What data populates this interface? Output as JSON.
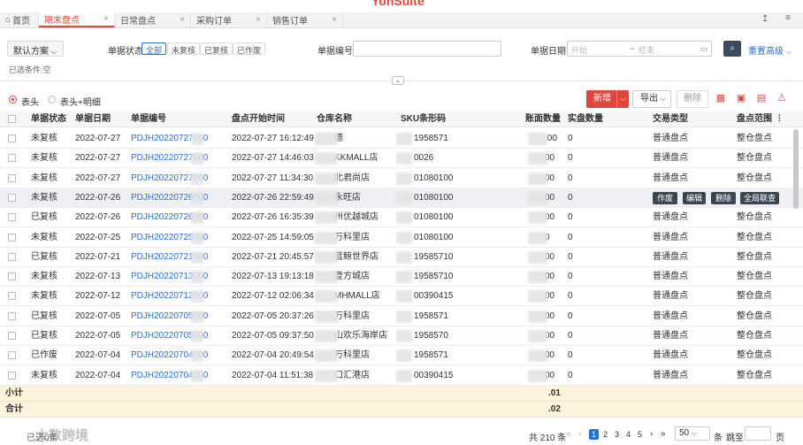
{
  "brand": "YonSuite",
  "tabs": [
    {
      "label": "首页",
      "active": false
    },
    {
      "label": "期末盘点",
      "active": true
    },
    {
      "label": "日常盘点",
      "active": false
    },
    {
      "label": "采购订单",
      "active": false
    },
    {
      "label": "销售订单",
      "active": false
    }
  ],
  "filter": {
    "scheme_label": "默认方案",
    "status_label": "单据状态",
    "status_options": [
      "全部",
      "未复核",
      "已复核",
      "已作废"
    ],
    "doc_no_label": "单据编号",
    "doc_no_value": "",
    "date_label": "单据日期",
    "date_start_placeholder": "开始",
    "date_sep": "~",
    "date_end_placeholder": "结束",
    "reset_label": "重置",
    "advanced_label": "高级",
    "selected_condition": "已选条件:空"
  },
  "view": {
    "option_header": "表头",
    "option_header_detail": "表头+明细"
  },
  "toolbar": {
    "add_label": "新增",
    "export_label": "导出",
    "delete_label": "删除"
  },
  "table": {
    "columns": [
      "单据状态",
      "单据日期",
      "单据编号",
      "盘点开始时间",
      "仓库名称",
      "SKU条形码",
      "账面数量",
      "实盘数量",
      "交易类型",
      "盘点范围"
    ],
    "rows": [
      {
        "status": "未复核",
        "date": "2022-07-27",
        "code": "PDJH20220727000",
        "start": "2022-07-27 16:12:49",
        "warehouse": "德",
        "sku": "1958571",
        "book_qty": ".00",
        "actual_qty": "0",
        "type": "普通盘点",
        "range": "整仓盘点"
      },
      {
        "status": "未复核",
        "date": "2022-07-27",
        "code": "PDJH20220727000",
        "start": "2022-07-27 14:46:03",
        "warehouse": "KKMALL店",
        "sku": "0026",
        "book_qty": "00",
        "actual_qty": "0",
        "type": "普通盘点",
        "range": "整仓盘点"
      },
      {
        "status": "未复核",
        "date": "2022-07-27",
        "code": "PDJH20220727000",
        "start": "2022-07-27 11:34:30",
        "warehouse": "北君尚店",
        "sku": "01080100",
        "book_qty": "00",
        "actual_qty": "0",
        "type": "普通盘点",
        "range": "整仓盘点"
      },
      {
        "status": "未复核",
        "date": "2022-07-26",
        "code": "PDJH20220726000",
        "start": "2022-07-26 22:59:49",
        "warehouse": "永旺店",
        "sku": "01080100",
        "book_qty": "00",
        "actual_qty": "0",
        "type": "作废",
        "range": "",
        "hover": true
      },
      {
        "status": "已复核",
        "date": "2022-07-26",
        "code": "PDJH20220726000",
        "start": "2022-07-26 16:35:39",
        "warehouse": "州优越城店",
        "sku": "01080100",
        "book_qty": "00",
        "actual_qty": "0",
        "type": "普通盘点",
        "range": "整仓盘点"
      },
      {
        "status": "未复核",
        "date": "2022-07-25",
        "code": "PDJH20220725000",
        "start": "2022-07-25 14:59:05",
        "warehouse": "万科里店",
        "sku": "01080100",
        "book_qty": "0",
        "actual_qty": "0",
        "type": "普通盘点",
        "range": "整仓盘点"
      },
      {
        "status": "已复核",
        "date": "2022-07-21",
        "code": "PDJH20220721000",
        "start": "2022-07-21 20:45:57",
        "warehouse": "蓝鲸世界店",
        "sku": "19585710",
        "book_qty": "00",
        "actual_qty": "0",
        "type": "普通盘点",
        "range": "整仓盘点"
      },
      {
        "status": "未复核",
        "date": "2022-07-13",
        "code": "PDJH20220713000",
        "start": "2022-07-13 19:13:18",
        "warehouse": "壹方城店",
        "sku": "19585710",
        "book_qty": "00",
        "actual_qty": "0",
        "type": "普通盘点",
        "range": "整仓盘点"
      },
      {
        "status": "未复核",
        "date": "2022-07-12",
        "code": "PDJH20220712000",
        "start": "2022-07-12 02:06:34",
        "warehouse": "MHMALL店",
        "sku": "00390415",
        "book_qty": "00",
        "actual_qty": "0",
        "type": "普通盘点",
        "range": "整仓盘点"
      },
      {
        "status": "已复核",
        "date": "2022-07-05",
        "code": "PDJH20220705000",
        "start": "2022-07-05 20:37:26",
        "warehouse": "万科里店",
        "sku": "1958571",
        "book_qty": "00",
        "actual_qty": "0",
        "type": "普通盘点",
        "range": "整仓盘点"
      },
      {
        "status": "已复核",
        "date": "2022-07-05",
        "code": "PDJH20220705000",
        "start": "2022-07-05 09:37:50",
        "warehouse": "山欢乐海岸店",
        "sku": "1958570",
        "book_qty": "00",
        "actual_qty": "0",
        "type": "普通盘点",
        "range": "整仓盘点"
      },
      {
        "status": "已作废",
        "date": "2022-07-04",
        "code": "PDJH20220704000",
        "start": "2022-07-04 20:49:54",
        "warehouse": "万科里店",
        "sku": "1958571",
        "book_qty": "00",
        "actual_qty": "0",
        "type": "普通盘点",
        "range": "整仓盘点"
      },
      {
        "status": "未复核",
        "date": "2022-07-04",
        "code": "PDJH20220704000",
        "start": "2022-07-04 11:51:38",
        "warehouse": "口汇港店",
        "sku": "00390415",
        "book_qty": "00",
        "actual_qty": "0",
        "type": "普通盘点",
        "range": "整仓盘点"
      }
    ],
    "row_actions": [
      "作废",
      "编辑",
      "删除",
      "全局联查"
    ],
    "subtotal_label": "小计",
    "subtotal_value": ".01",
    "total_label": "合计",
    "total_value": ".02"
  },
  "pager": {
    "selected_label": "已选0条",
    "total_label": "共 210 条",
    "pages": [
      "1",
      "2",
      "3",
      "4",
      "5"
    ],
    "current_page": "1",
    "page_size": "50",
    "page_size_unit": "条",
    "jump_label": "跳至",
    "page_unit": "页"
  },
  "watermark": "大数跨境",
  "colors": {
    "accent": "#e0463d",
    "link": "#2b6fd6",
    "dark_button": "#3b4a5c",
    "subtotal_bg": "#fdf3dc"
  }
}
